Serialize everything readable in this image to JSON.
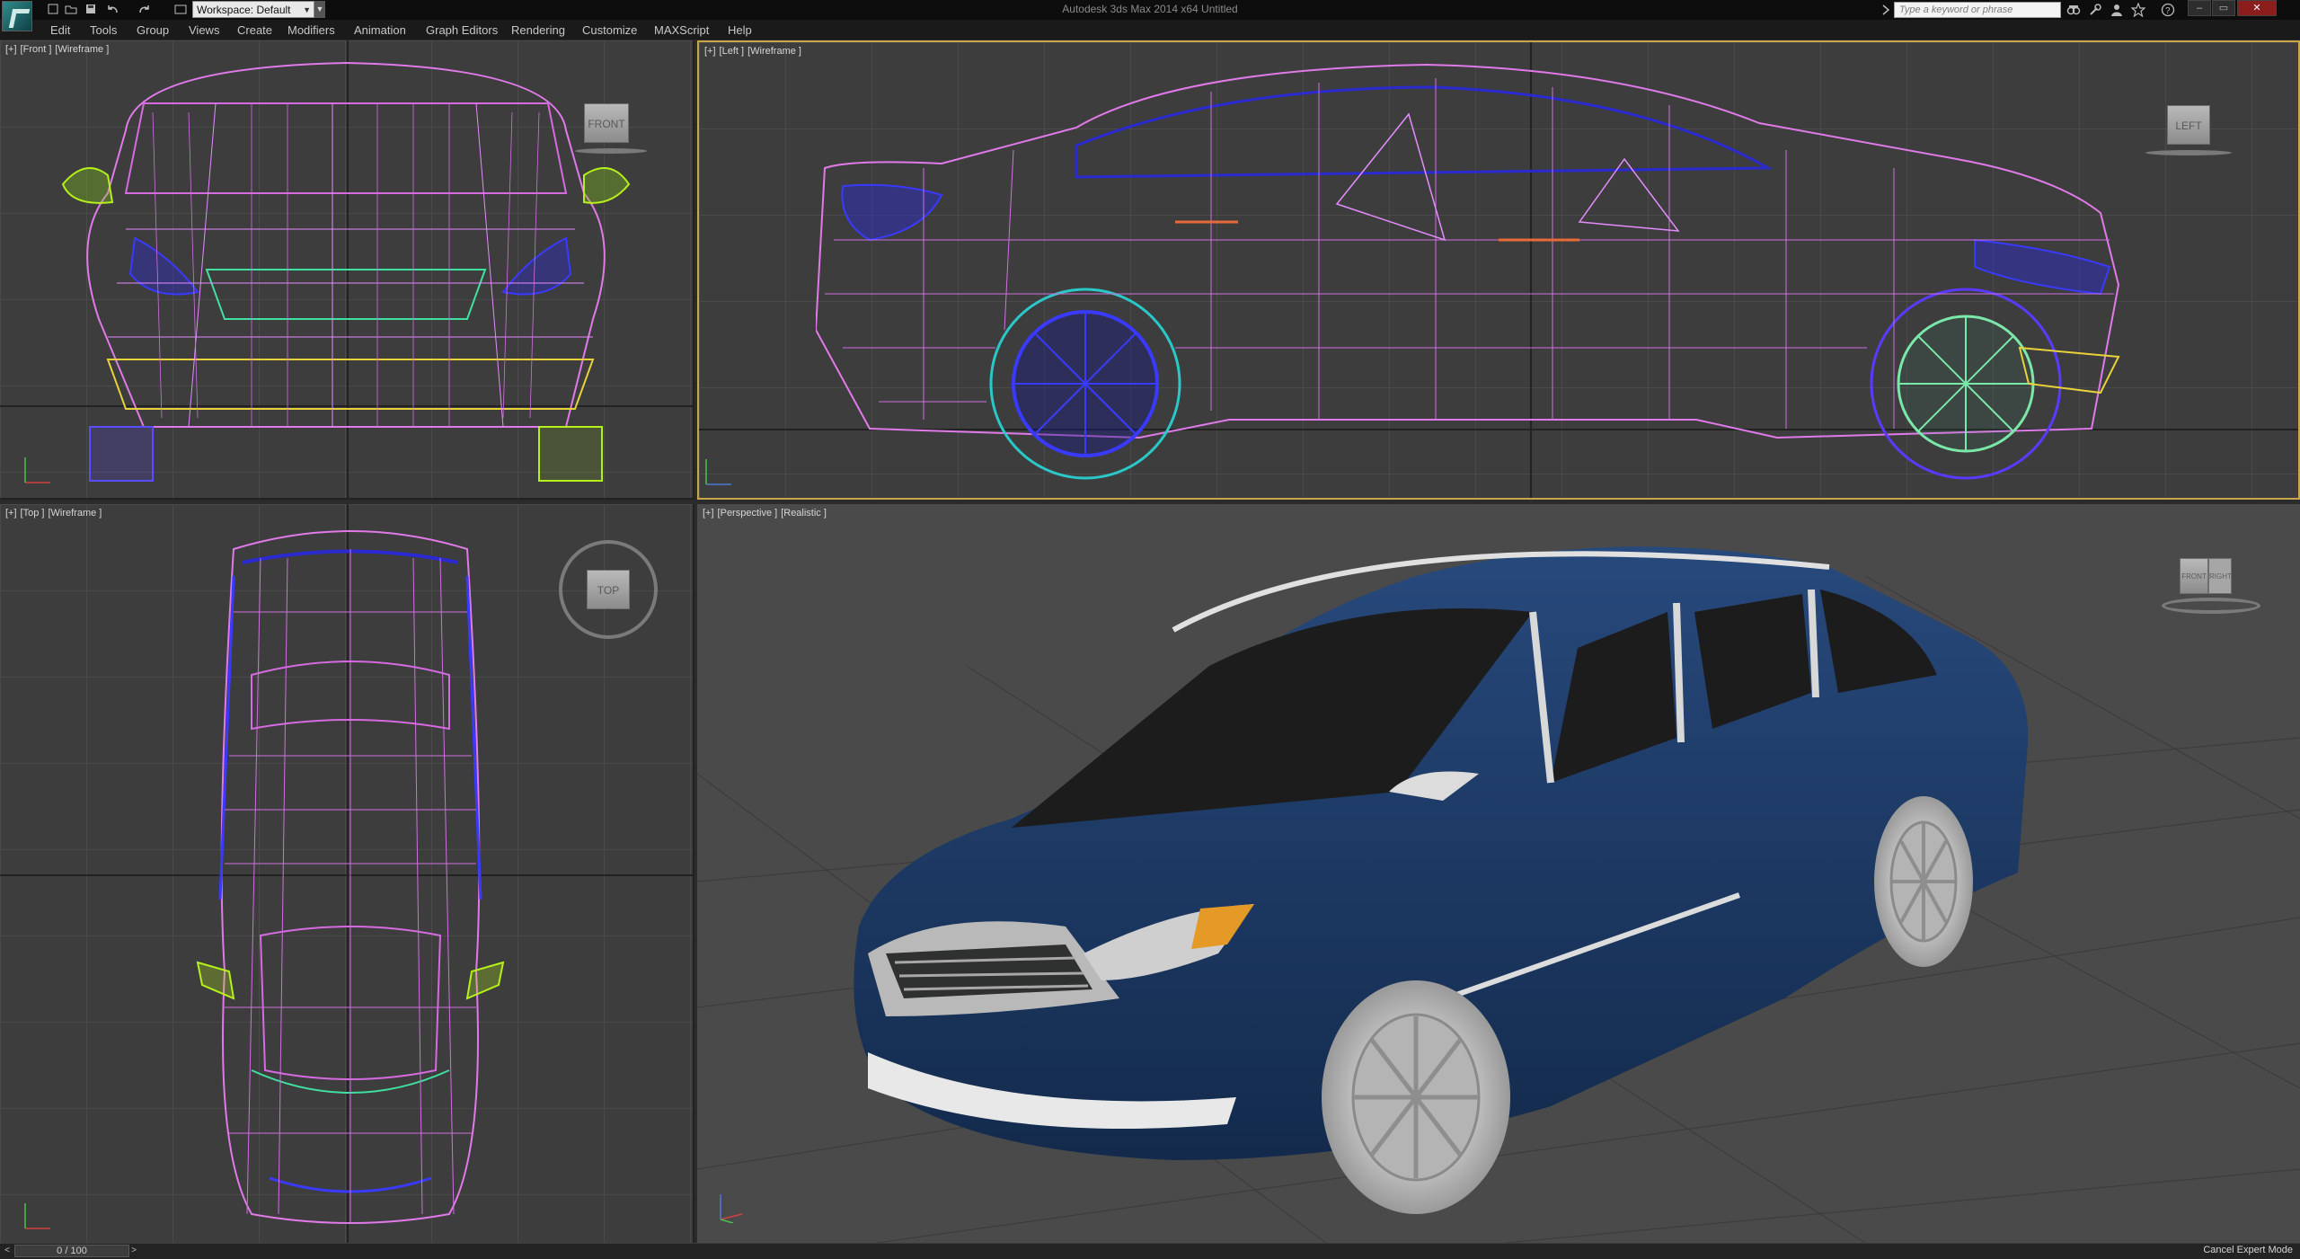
{
  "titlebar": {
    "app_title": "Autodesk 3ds Max  2014 x64     Untitled",
    "workspace_label": "Workspace: Default",
    "search_placeholder": "Type a keyword or phrase"
  },
  "menubar": {
    "items": [
      "Edit",
      "Tools",
      "Group",
      "Views",
      "Create",
      "Modifiers",
      "Animation",
      "Graph Editors",
      "Rendering",
      "Customize",
      "MAXScript",
      "Help"
    ]
  },
  "viewports": {
    "front": {
      "plus": "[+]",
      "name": "[Front ]",
      "mode": "[Wireframe ]",
      "cube_label": "FRONT"
    },
    "left": {
      "plus": "[+]",
      "name": "[Left ]",
      "mode": "[Wireframe ]",
      "cube_label": "LEFT"
    },
    "top": {
      "plus": "[+]",
      "name": "[Top ]",
      "mode": "[Wireframe ]",
      "cube_label": "TOP"
    },
    "perspective": {
      "plus": "[+]",
      "name": "[Perspective ]",
      "mode": "[Realistic ]",
      "cube_labels": [
        "FRONT",
        "RIGHT"
      ]
    }
  },
  "statusbar": {
    "time_slider": "0 / 100",
    "prev_label": "<",
    "next_label": ">",
    "cancel_expert": "Cancel Expert Mode"
  },
  "icons": [
    "app-logo-icon",
    "new-file-icon",
    "open-file-icon",
    "save-icon",
    "undo-icon",
    "redo-icon",
    "project-folder-icon",
    "binoculars-icon",
    "tools-icon",
    "user-icon",
    "star-icon",
    "help-icon",
    "minimize-icon",
    "restore-icon",
    "close-icon"
  ],
  "colors": {
    "wireframe_primary": "#e07ae8",
    "wireframe_secondary": "#3a3aff",
    "car_paint": "#1c3a66",
    "active_viewport_border": "#c8a64a"
  }
}
